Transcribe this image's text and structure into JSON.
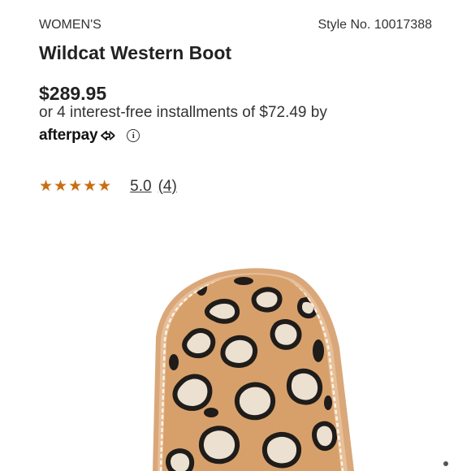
{
  "product": {
    "category": "WOMEN'S",
    "style_no": "Style No. 10017388",
    "title": "Wildcat Western Boot",
    "price": "$289.95",
    "installments_text": "or 4 interest-free installments of $72.49 by",
    "afterpay_label": "afterpay",
    "info_icon": "info-icon",
    "rating": {
      "stars": "★★★★★",
      "score": "5.0",
      "count": "(4)",
      "star_color": "#c96d13"
    }
  },
  "image": {
    "icon": "boot-toe-image"
  }
}
